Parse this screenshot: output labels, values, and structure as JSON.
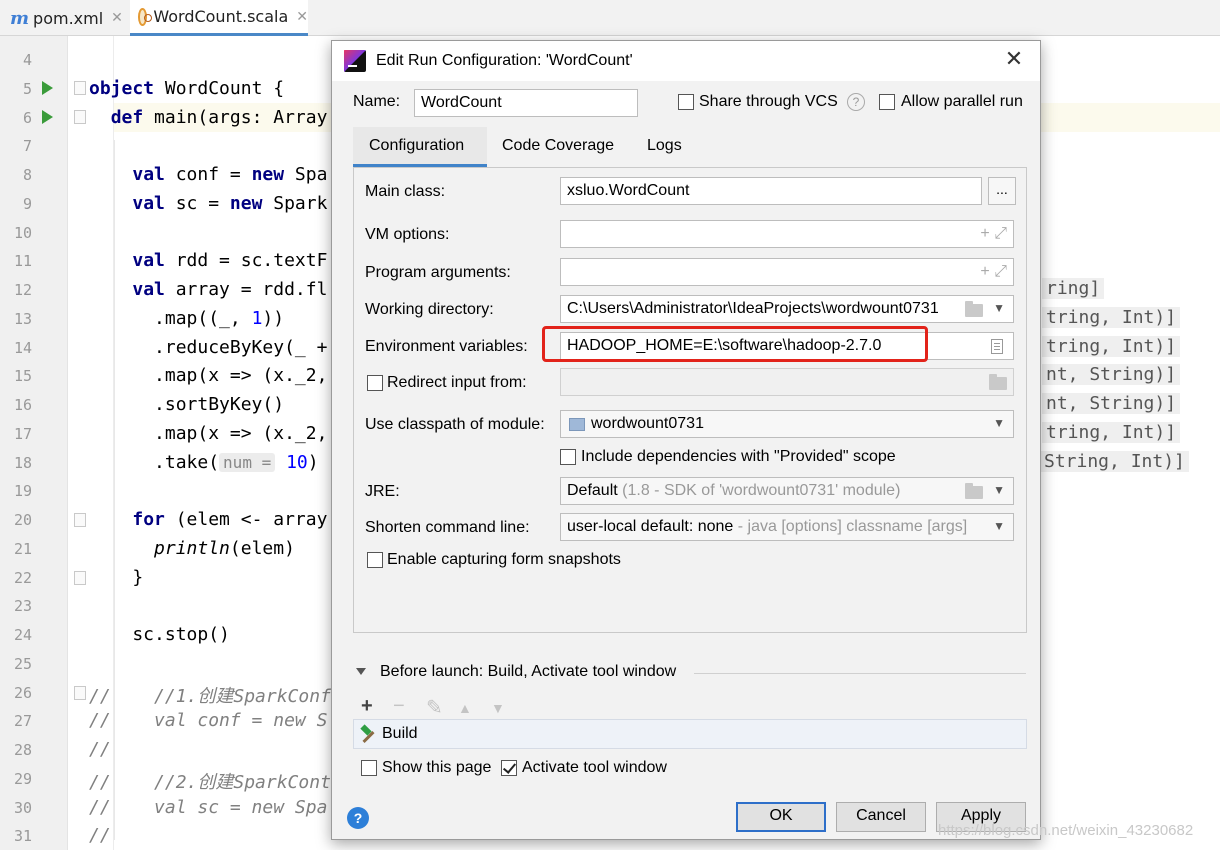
{
  "editor": {
    "tabs": [
      {
        "icon": "maven-icon",
        "glyph": "m",
        "label": "pom.xml"
      },
      {
        "icon": "scala-file-icon",
        "label": "WordCount.scala"
      }
    ],
    "lines": [
      {
        "n": "4",
        "html": ""
      },
      {
        "n": "5",
        "html": "<span class=\"kw\">object</span> WordCount {"
      },
      {
        "n": "6",
        "html": "  <span class=\"kw\">def</span> main(args: Array"
      },
      {
        "n": "7",
        "html": ""
      },
      {
        "n": "8",
        "html": "    <span class=\"kw\">val</span> conf = <span class=\"kw\">new</span> Spa"
      },
      {
        "n": "9",
        "html": "    <span class=\"kw\">val</span> sc = <span class=\"kw\">new</span> Spark"
      },
      {
        "n": "10",
        "html": ""
      },
      {
        "n": "11",
        "html": "    <span class=\"kw\">val</span> rdd = sc.textF"
      },
      {
        "n": "12",
        "html": "    <span class=\"kw\">val</span> array = rdd.fl"
      },
      {
        "n": "13",
        "html": "      .map((_, <span class=\"num\">1</span>))"
      },
      {
        "n": "14",
        "html": "      .reduceByKey(_ +"
      },
      {
        "n": "15",
        "html": "      .map(x =&gt; (x._2,"
      },
      {
        "n": "16",
        "html": "      .sortByKey()"
      },
      {
        "n": "17",
        "html": "      .map(x =&gt; (x._2,"
      },
      {
        "n": "18",
        "html": "      .take(<span class=\"hint\">num =</span> <span class=\"num\">10</span>)"
      },
      {
        "n": "19",
        "html": ""
      },
      {
        "n": "20",
        "html": "    <span class=\"kw\">for</span> (elem &lt;- array"
      },
      {
        "n": "21",
        "html": "      <span class=\"it\">println</span>(elem)"
      },
      {
        "n": "22",
        "html": "    }"
      },
      {
        "n": "23",
        "html": ""
      },
      {
        "n": "24",
        "html": "    sc.stop()"
      },
      {
        "n": "25",
        "html": ""
      },
      {
        "n": "26",
        "html": "<span class=\"cm\">//    //1.创建SparkConf</span>"
      },
      {
        "n": "27",
        "html": "<span class=\"cm\">//    val conf = new S</span>"
      },
      {
        "n": "28",
        "html": "<span class=\"cm\">//</span>"
      },
      {
        "n": "29",
        "html": "<span class=\"cm\">//    //2.创建SparkConte</span>"
      },
      {
        "n": "30",
        "html": "<span class=\"cm\">//    val sc = new Spa</span>"
      },
      {
        "n": "31",
        "html": "<span class=\"cm\">//</span>"
      }
    ],
    "inlay_hints": [
      {
        "row": 12,
        "text": "ring]"
      },
      {
        "row": 13,
        "text": "tring, Int)]"
      },
      {
        "row": 14,
        "text": "tring, Int)]"
      },
      {
        "row": 15,
        "text": "nt, String)]"
      },
      {
        "row": 16,
        "text": "nt, String)]"
      },
      {
        "row": 17,
        "text": "tring, Int)]"
      },
      {
        "row": 18,
        "text": "String, Int)]"
      }
    ]
  },
  "dialog": {
    "title": "Edit Run Configuration: 'WordCount'",
    "name_label": "Name:",
    "name_value": "WordCount",
    "share_vcs_label": "Share through VCS",
    "share_vcs_checked": false,
    "allow_parallel_label": "Allow parallel run",
    "allow_parallel_checked": false,
    "tabs": [
      "Configuration",
      "Code Coverage",
      "Logs"
    ],
    "active_tab": "Configuration",
    "fields": {
      "main_class_label": "Main class:",
      "main_class_value": "xsluo.WordCount",
      "main_class_button": "...",
      "vm_options_label": "VM options:",
      "vm_options_value": "",
      "program_args_label": "Program arguments:",
      "program_args_value": "",
      "working_dir_label": "Working directory:",
      "working_dir_value": "C:\\Users\\Administrator\\IdeaProjects\\wordwount0731",
      "env_vars_label": "Environment variables:",
      "env_vars_value": "HADOOP_HOME=E:\\software\\hadoop-2.7.0",
      "redirect_input_label": "Redirect input from:",
      "redirect_input_checked": false,
      "classpath_label": "Use classpath of module:",
      "classpath_value": "wordwount0731",
      "include_provided_label": "Include dependencies with \"Provided\" scope",
      "include_provided_checked": false,
      "jre_label": "JRE:",
      "jre_value_main": "Default",
      "jre_value_detail": "(1.8 - SDK of 'wordwount0731' module)",
      "shorten_label": "Shorten command line:",
      "shorten_value_main": "user-local default: none",
      "shorten_value_detail": "- java [options] classname [args]",
      "snapshots_label": "Enable capturing form snapshots",
      "snapshots_checked": false
    },
    "before_launch": {
      "title": "Before launch: Build, Activate tool window",
      "items": [
        "Build"
      ],
      "show_page_label": "Show this page",
      "show_page_checked": false,
      "activate_tool_label": "Activate tool window",
      "activate_tool_checked": true
    },
    "buttons": {
      "ok": "OK",
      "cancel": "Cancel",
      "apply": "Apply"
    },
    "help_glyph": "?"
  },
  "watermark": "https://blog.csdn.net/weixin_43230682",
  "colors": {
    "highlight": "#e2231a",
    "keyword": "#000080",
    "number": "#0000ff",
    "accent": "#4083c9"
  }
}
